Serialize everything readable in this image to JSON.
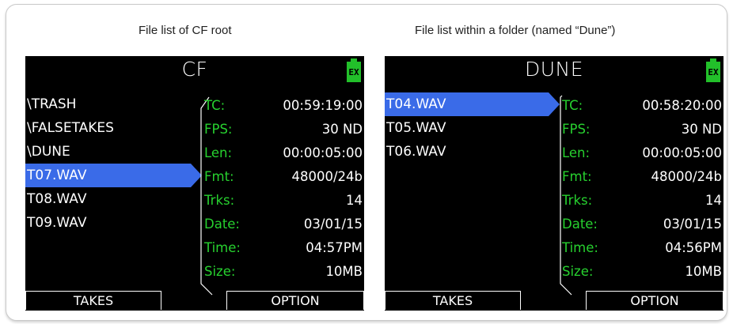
{
  "captions": {
    "left": "File list of CF root",
    "right": "File list within a folder (named “Dune”)"
  },
  "colors": {
    "screen_bg": "#000000",
    "selection": "#3a6be8",
    "label_green": "#27d12f",
    "battery_green": "#22c02a"
  },
  "left_screen": {
    "title": "CF",
    "battery_label": "EX",
    "files": [
      "\\TRASH",
      "\\FALSETAKES",
      "\\DUNE",
      "T07.WAV",
      "T08.WAV",
      "T09.WAV"
    ],
    "selected_index": 3,
    "info": [
      {
        "label": "TC:",
        "value": "00:59:19:00"
      },
      {
        "label": "FPS:",
        "value": "30 ND"
      },
      {
        "label": "Len:",
        "value": "00:00:05:00"
      },
      {
        "label": "Fmt:",
        "value": "48000/24b"
      },
      {
        "label": "Trks:",
        "value": "14"
      },
      {
        "label": "Date:",
        "value": "03/01/15"
      },
      {
        "label": "Time:",
        "value": "04:57PM"
      },
      {
        "label": "Size:",
        "value": "10MB"
      }
    ],
    "softkey_left": "TAKES",
    "softkey_right": "OPTION"
  },
  "right_screen": {
    "title": "DUNE",
    "battery_label": "EX",
    "files": [
      "T04.WAV",
      "T05.WAV",
      "T06.WAV"
    ],
    "selected_index": 0,
    "info": [
      {
        "label": "TC:",
        "value": "00:58:20:00"
      },
      {
        "label": "FPS:",
        "value": "30 ND"
      },
      {
        "label": "Len:",
        "value": "00:00:05:00"
      },
      {
        "label": "Fmt:",
        "value": "48000/24b"
      },
      {
        "label": "Trks:",
        "value": "14"
      },
      {
        "label": "Date:",
        "value": "03/01/15"
      },
      {
        "label": "Time:",
        "value": "04:56PM"
      },
      {
        "label": "Size:",
        "value": "10MB"
      }
    ],
    "softkey_left": "TAKES",
    "softkey_right": "OPTION"
  }
}
